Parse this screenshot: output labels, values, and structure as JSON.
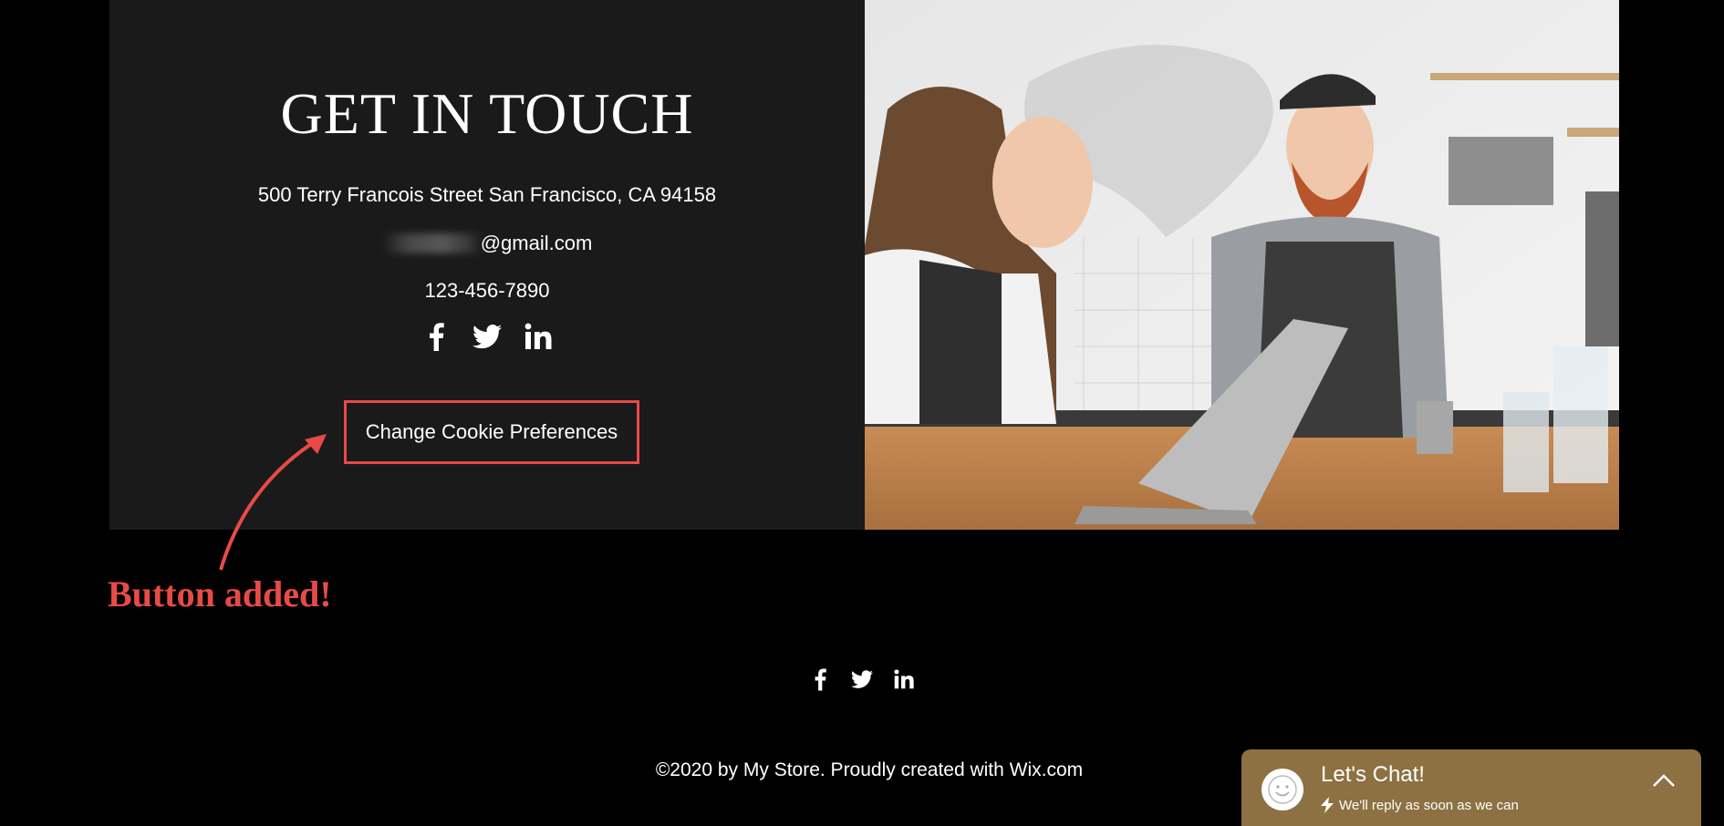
{
  "contact": {
    "heading": "GET IN TOUCH",
    "address": "500 Terry Francois Street San Francisco, CA 94158",
    "email_visible": "@gmail.com",
    "phone": "123-456-7890",
    "social_icons": [
      "facebook-icon",
      "twitter-icon",
      "linkedin-icon"
    ],
    "cookie_button": "Change Cookie Preferences"
  },
  "annotation": {
    "text": "Button added!",
    "color": "#e84a47"
  },
  "footer": {
    "social_icons": [
      "facebook-icon",
      "twitter-icon",
      "linkedin-icon"
    ],
    "copyright": "©2020 by My Store. Proudly created with Wix.com"
  },
  "chat": {
    "title": "Let's Chat!",
    "subtitle": "We'll reply as soon as we can",
    "color": "#8d7143"
  }
}
